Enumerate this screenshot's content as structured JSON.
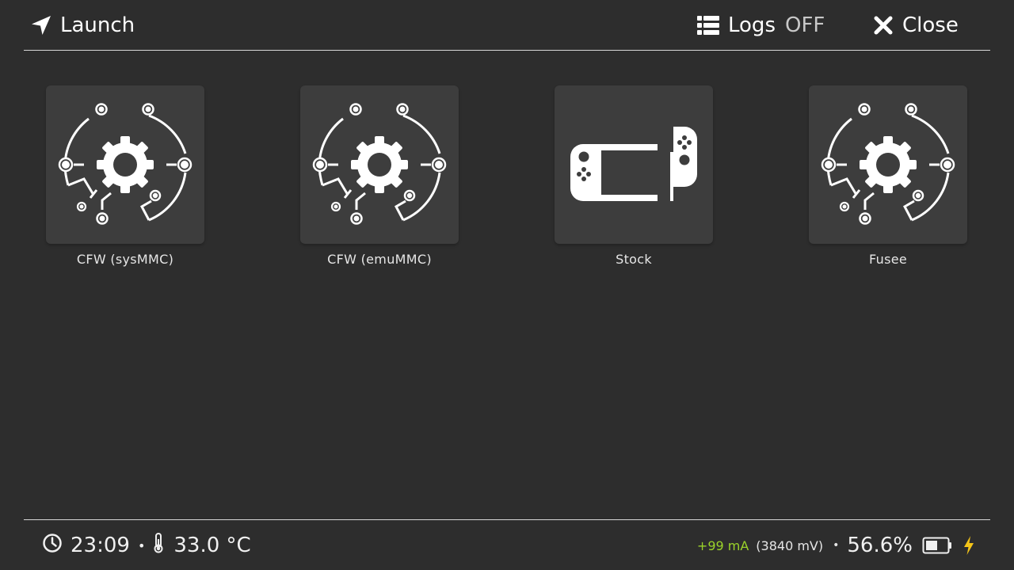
{
  "header": {
    "launch_label": "Launch",
    "logs_label": "Logs",
    "logs_state": "OFF",
    "close_label": "Close"
  },
  "tiles": [
    {
      "label": "CFW (sysMMC)",
      "icon": "gear-circuit-icon"
    },
    {
      "label": "CFW (emuMMC)",
      "icon": "gear-circuit-icon"
    },
    {
      "label": "Stock",
      "icon": "switch-console-icon"
    },
    {
      "label": "Fusee",
      "icon": "gear-circuit-icon"
    }
  ],
  "status": {
    "time": "23:09",
    "temperature": "33.0 °C",
    "current": "+99 mA",
    "voltage": "(3840 mV)",
    "battery_percent": "56.6%",
    "battery_level": 0.566,
    "charging": true
  },
  "colors": {
    "background": "#2d2d2d",
    "tile": "#3d3d3d",
    "current_positive": "#9bd32a",
    "charge_bolt": "#f5c518",
    "logs_off": "#c8c8c8"
  }
}
